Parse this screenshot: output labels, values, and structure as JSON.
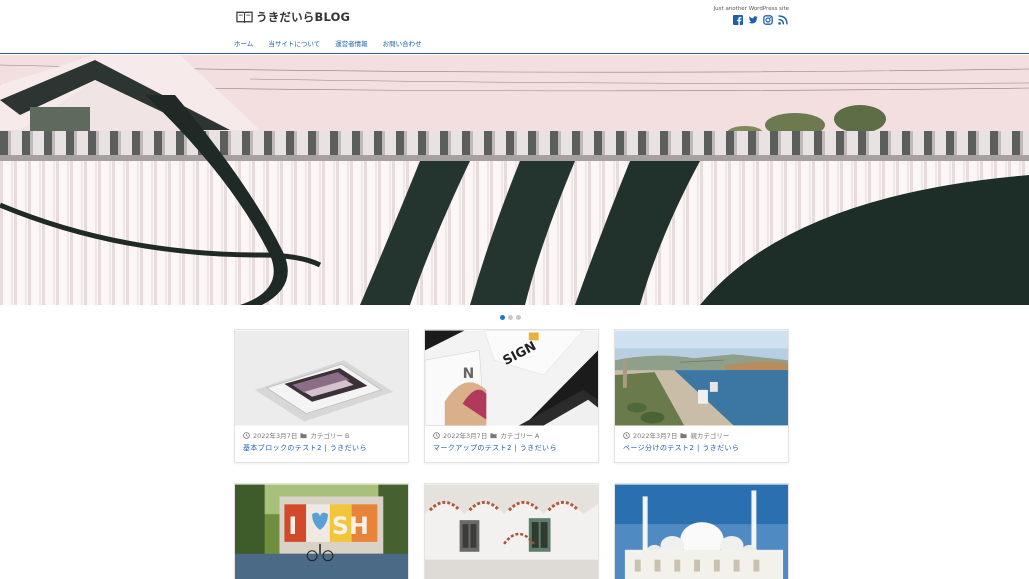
{
  "site": {
    "name": "うきだいらBLOG",
    "tagline": "Just another WordPress site"
  },
  "social": [
    "facebook-icon",
    "twitter-icon",
    "instagram-icon",
    "rss-icon"
  ],
  "nav": [
    "ホーム",
    "当サイトについて",
    "運営者情報",
    "お問い合わせ"
  ],
  "slider": {
    "slide_count": 3,
    "active_index": 0
  },
  "colors": {
    "accent": "#1e5fb3",
    "link": "#1e5fb3",
    "dot_active": "#1e73d2"
  },
  "posts": [
    {
      "date": "2022年3月7日",
      "category": "カテゴリー B",
      "title": "基本ブロックのテスト2 | うきだいら"
    },
    {
      "date": "2022年3月7日",
      "category": "カテゴリー A",
      "title": "マークアップのテスト2 | うきだいら"
    },
    {
      "date": "2022年3月7日",
      "category": "親カテゴリー",
      "title": "ページ分けのテスト2 | うきだいら"
    },
    {
      "date": "",
      "category": "",
      "title": ""
    },
    {
      "date": "",
      "category": "",
      "title": ""
    },
    {
      "date": "",
      "category": "",
      "title": ""
    }
  ],
  "thumb_text": {
    "design": "SIGN",
    "design_letter": "N",
    "wish_left": "I",
    "wish_right": "SH"
  }
}
